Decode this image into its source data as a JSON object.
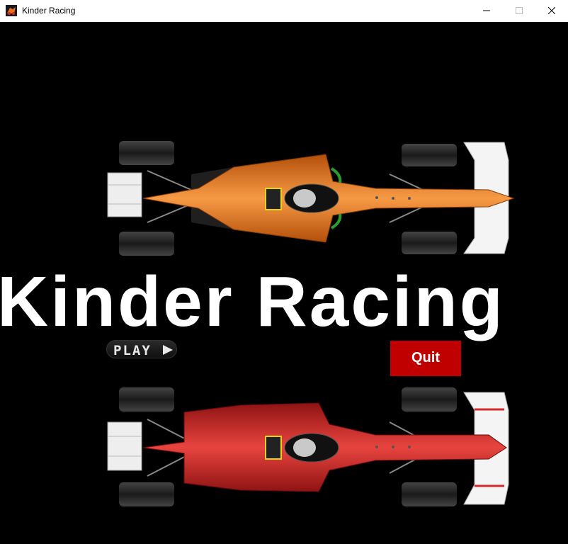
{
  "window": {
    "title": "Kinder Racing",
    "icon": "kinder-racing-app-icon",
    "controls": [
      "minimize-icon",
      "maximize-icon",
      "close-icon"
    ]
  },
  "game": {
    "title": "Kinder Racing",
    "play_label": "PLAY",
    "quit_label": "Quit",
    "cars": [
      {
        "name": "orange-race-car",
        "color": "#e8701a"
      },
      {
        "name": "red-race-car",
        "color": "#d42a2a"
      }
    ],
    "colors": {
      "background": "#000000",
      "quit": "#c00000",
      "title": "#ffffff"
    }
  }
}
